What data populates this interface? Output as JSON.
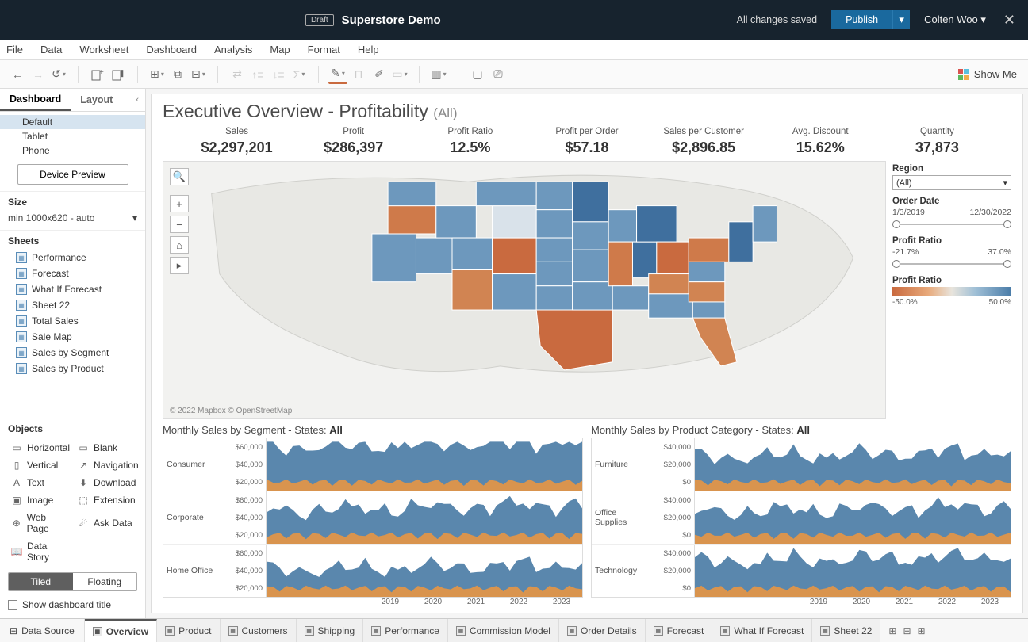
{
  "titlebar": {
    "draft": "Draft",
    "docname": "Superstore Demo",
    "saved": "All changes saved",
    "publish": "Publish",
    "user": "Colten Woo"
  },
  "menus": [
    "File",
    "Data",
    "Worksheet",
    "Dashboard",
    "Analysis",
    "Map",
    "Format",
    "Help"
  ],
  "showme": "Show Me",
  "sidebar": {
    "tabs": {
      "dashboard": "Dashboard",
      "layout": "Layout"
    },
    "devices": [
      "Default",
      "Tablet",
      "Phone"
    ],
    "device_preview": "Device Preview",
    "size": {
      "title": "Size",
      "value": "min 1000x620 - auto"
    },
    "sheets": {
      "title": "Sheets",
      "items": [
        "Performance",
        "Forecast",
        "What If Forecast",
        "Sheet 22",
        "Total Sales",
        "Sale Map",
        "Sales by Segment",
        "Sales by Product"
      ]
    },
    "objects": {
      "title": "Objects",
      "items": [
        {
          "ico": "▭",
          "label": "Horizontal"
        },
        {
          "ico": "▭",
          "label": "Blank"
        },
        {
          "ico": "▯",
          "label": "Vertical"
        },
        {
          "ico": "↗",
          "label": "Navigation"
        },
        {
          "ico": "A",
          "label": "Text"
        },
        {
          "ico": "⬇",
          "label": "Download"
        },
        {
          "ico": "▣",
          "label": "Image"
        },
        {
          "ico": "⬚",
          "label": "Extension"
        },
        {
          "ico": "⊕",
          "label": "Web Page"
        },
        {
          "ico": "☄",
          "label": "Ask Data"
        },
        {
          "ico": "📖",
          "label": "Data Story"
        }
      ]
    },
    "tiled": "Tiled",
    "floating": "Floating",
    "show_title": "Show dashboard title"
  },
  "dash": {
    "title_main": "Executive Overview - Profitability ",
    "title_sub": "(All)",
    "kpis": [
      {
        "label": "Sales",
        "value": "$2,297,201"
      },
      {
        "label": "Profit",
        "value": "$286,397"
      },
      {
        "label": "Profit Ratio",
        "value": "12.5%"
      },
      {
        "label": "Profit per Order",
        "value": "$57.18"
      },
      {
        "label": "Sales per Customer",
        "value": "$2,896.85"
      },
      {
        "label": "Avg. Discount",
        "value": "15.62%"
      },
      {
        "label": "Quantity",
        "value": "37,873"
      }
    ],
    "map_attr": "© 2022 Mapbox   © OpenStreetMap",
    "filters": {
      "region": {
        "title": "Region",
        "value": "(All)"
      },
      "order_date": {
        "title": "Order Date",
        "start": "1/3/2019",
        "end": "12/30/2022"
      },
      "pr_range": {
        "title": "Profit Ratio",
        "min": "-21.7%",
        "max": "37.0%"
      },
      "pr_legend": {
        "title": "Profit Ratio",
        "min": "-50.0%",
        "max": "50.0%"
      }
    },
    "bottom_left": {
      "title": "Monthly Sales by Segment - States: ",
      "bold": "All",
      "rows": [
        "Consumer",
        "Corporate",
        "Home Office"
      ]
    },
    "bottom_right": {
      "title": "Monthly Sales by Product Category - States: ",
      "bold": "All",
      "rows": [
        "Furniture",
        "Office Supplies",
        "Technology"
      ]
    },
    "y_left": [
      "$60,000",
      "$40,000",
      "$20,000"
    ],
    "y_right": [
      "$40,000",
      "$20,000",
      "$0"
    ],
    "xaxis": [
      "2019",
      "2020",
      "2021",
      "2022",
      "2023"
    ]
  },
  "tabs": {
    "data_source": "Data Source",
    "sheets": [
      "Overview",
      "Product",
      "Customers",
      "Shipping",
      "Performance",
      "Commission Model",
      "Order Details",
      "Forecast",
      "What If Forecast",
      "Sheet 22"
    ]
  },
  "chart_data": {
    "map": {
      "type": "choropleth",
      "geography": "US states",
      "color_field": "Profit Ratio",
      "color_range": [
        -50.0,
        50.0
      ],
      "color_scale": "diverging orange-blue",
      "note": "Most states rendered blue (positive profit ratio). Orange/negative states include roughly TX, CO, AZ, OR, OH, IL, TN, NC, PA, FL."
    },
    "monthly_sales_by_segment": {
      "type": "area",
      "stacking": false,
      "x_axis": {
        "label": "Year",
        "range": [
          2019,
          2023
        ],
        "ticks": [
          2019,
          2020,
          2021,
          2022,
          2023
        ]
      },
      "y_axis": {
        "label": "Sales",
        "ticks": [
          20000,
          40000,
          60000
        ]
      },
      "facets": [
        {
          "segment": "Consumer",
          "approx_avg": 35000,
          "approx_peak": 70000
        },
        {
          "segment": "Corporate",
          "approx_avg": 22000,
          "approx_peak": 60000
        },
        {
          "segment": "Home Office",
          "approx_avg": 14000,
          "approx_peak": 45000
        }
      ],
      "stacked_series_per_facet": [
        "lower (orange)",
        "upper (blue)"
      ]
    },
    "monthly_sales_by_category": {
      "type": "area",
      "stacking": false,
      "x_axis": {
        "label": "Year",
        "range": [
          2019,
          2023
        ],
        "ticks": [
          2019,
          2020,
          2021,
          2022,
          2023
        ]
      },
      "y_axis": {
        "label": "Sales",
        "ticks": [
          0,
          20000,
          40000
        ]
      },
      "facets": [
        {
          "category": "Furniture",
          "approx_avg": 18000,
          "approx_peak": 42000
        },
        {
          "category": "Office Supplies",
          "approx_avg": 17000,
          "approx_peak": 40000
        },
        {
          "category": "Technology",
          "approx_avg": 18000,
          "approx_peak": 50000
        }
      ],
      "stacked_series_per_facet": [
        "lower (orange)",
        "upper (blue)"
      ]
    }
  }
}
